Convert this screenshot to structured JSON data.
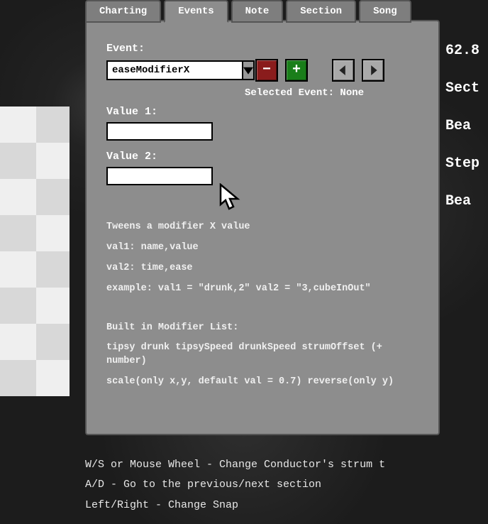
{
  "tabs": {
    "charting": "Charting",
    "events": "Events",
    "note": "Note",
    "section": "Section",
    "song": "Song"
  },
  "activeTab": "events",
  "eventPanel": {
    "eventLabel": "Event:",
    "eventValue": "easeModifierX",
    "selectedLabel": "Selected Event: None",
    "value1Label": "Value 1:",
    "value1": "",
    "value2Label": "Value 2:",
    "value2": "",
    "desc": {
      "l1": "Tweens a modifier X value",
      "l2": "val1: name,value",
      "l3": "val2: time,ease",
      "l4": "example: val1 = \"drunk,2\" val2 = \"3,cubeInOut\"",
      "l5": "Built in Modifier List:",
      "l6": "tipsy  drunk  tipsySpeed  drunkSpeed  strumOffset (+ number)",
      "l7": "scale(only x,y, default val = 0.7)  reverse(only y)"
    }
  },
  "rightInfo": {
    "r1": "62.8",
    "r2": "Sect",
    "r3": "Bea",
    "r4": "Step",
    "r5": "Bea"
  },
  "help": {
    "h1": "W/S or Mouse Wheel - Change Conductor's strum t",
    "h2": "A/D - Go to the previous/next section",
    "h3": "Left/Right - Change Snap"
  },
  "icons": {
    "minus": "−",
    "plus": "+"
  }
}
